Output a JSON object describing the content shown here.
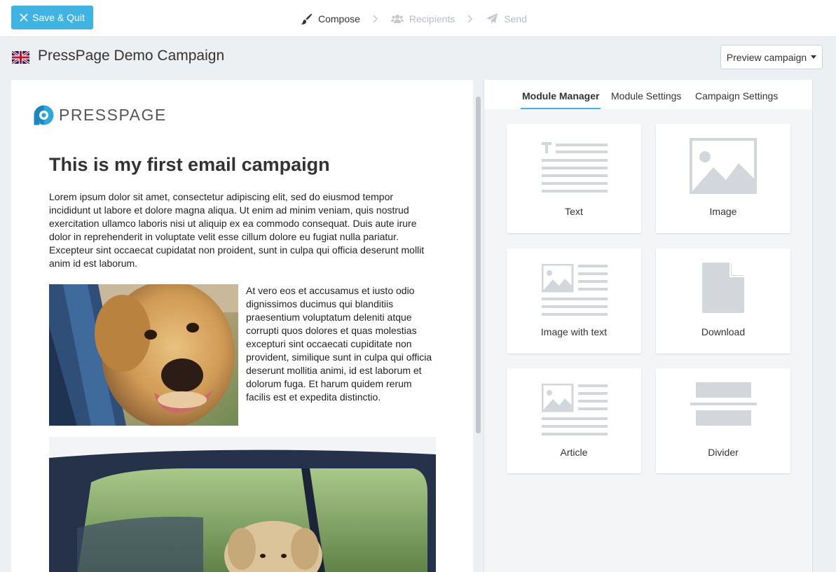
{
  "topbar": {
    "save_label": "Save & Quit",
    "steps": [
      {
        "label": "Compose",
        "icon": "brush-icon",
        "state": "active"
      },
      {
        "label": "Recipients",
        "icon": "users-icon",
        "state": "inactive"
      },
      {
        "label": "Send",
        "icon": "paper-plane-icon",
        "state": "inactive"
      }
    ]
  },
  "header": {
    "flag_icon": "uk-flag-icon",
    "campaign_title": "PressPage Demo Campaign",
    "preview_label": "Preview campaign"
  },
  "email": {
    "logo_text": "PRESSPAGE",
    "heading": "This is my first email campaign",
    "paragraph1": "Lorem ipsum dolor sit amet, consectetur adipiscing elit, sed do eiusmod tempor incididunt ut labore et dolore magna aliqua. Ut enim ad minim veniam, quis nostrud exercitation ullamco laboris nisi ut aliquip ex ea commodo consequat. Duis aute irure dolor in reprehenderit in voluptate velit esse cillum dolore eu fugiat nulla pariatur. Excepteur sint occaecat cupidatat non proident, sunt in culpa qui officia deserunt mollit anim id est laborum.",
    "paragraph2": "At vero eos et accusamus et iusto odio dignissimos ducimus qui blanditiis praesentium voluptatum deleniti atque corrupti quos dolores et quas molestias excepturi sint occaecati cupiditate non provident, similique sunt in culpa qui officia deserunt mollitia animi, id est laborum et dolorum fuga. Et harum quidem rerum facilis est et expedita distinctio."
  },
  "panel": {
    "tabs": [
      {
        "label": "Module Manager",
        "active": true
      },
      {
        "label": "Module Settings",
        "active": false
      },
      {
        "label": "Campaign Settings",
        "active": false
      }
    ],
    "modules": [
      {
        "label": "Text",
        "icon": "text-module-icon"
      },
      {
        "label": "Image",
        "icon": "image-module-icon"
      },
      {
        "label": "Image with text",
        "icon": "image-with-text-module-icon"
      },
      {
        "label": "Download",
        "icon": "download-module-icon"
      },
      {
        "label": "Article",
        "icon": "article-module-icon"
      },
      {
        "label": "Divider",
        "icon": "divider-module-icon"
      }
    ]
  },
  "colors": {
    "accent": "#3fb4e3",
    "module_icon": "#d3d6da"
  }
}
